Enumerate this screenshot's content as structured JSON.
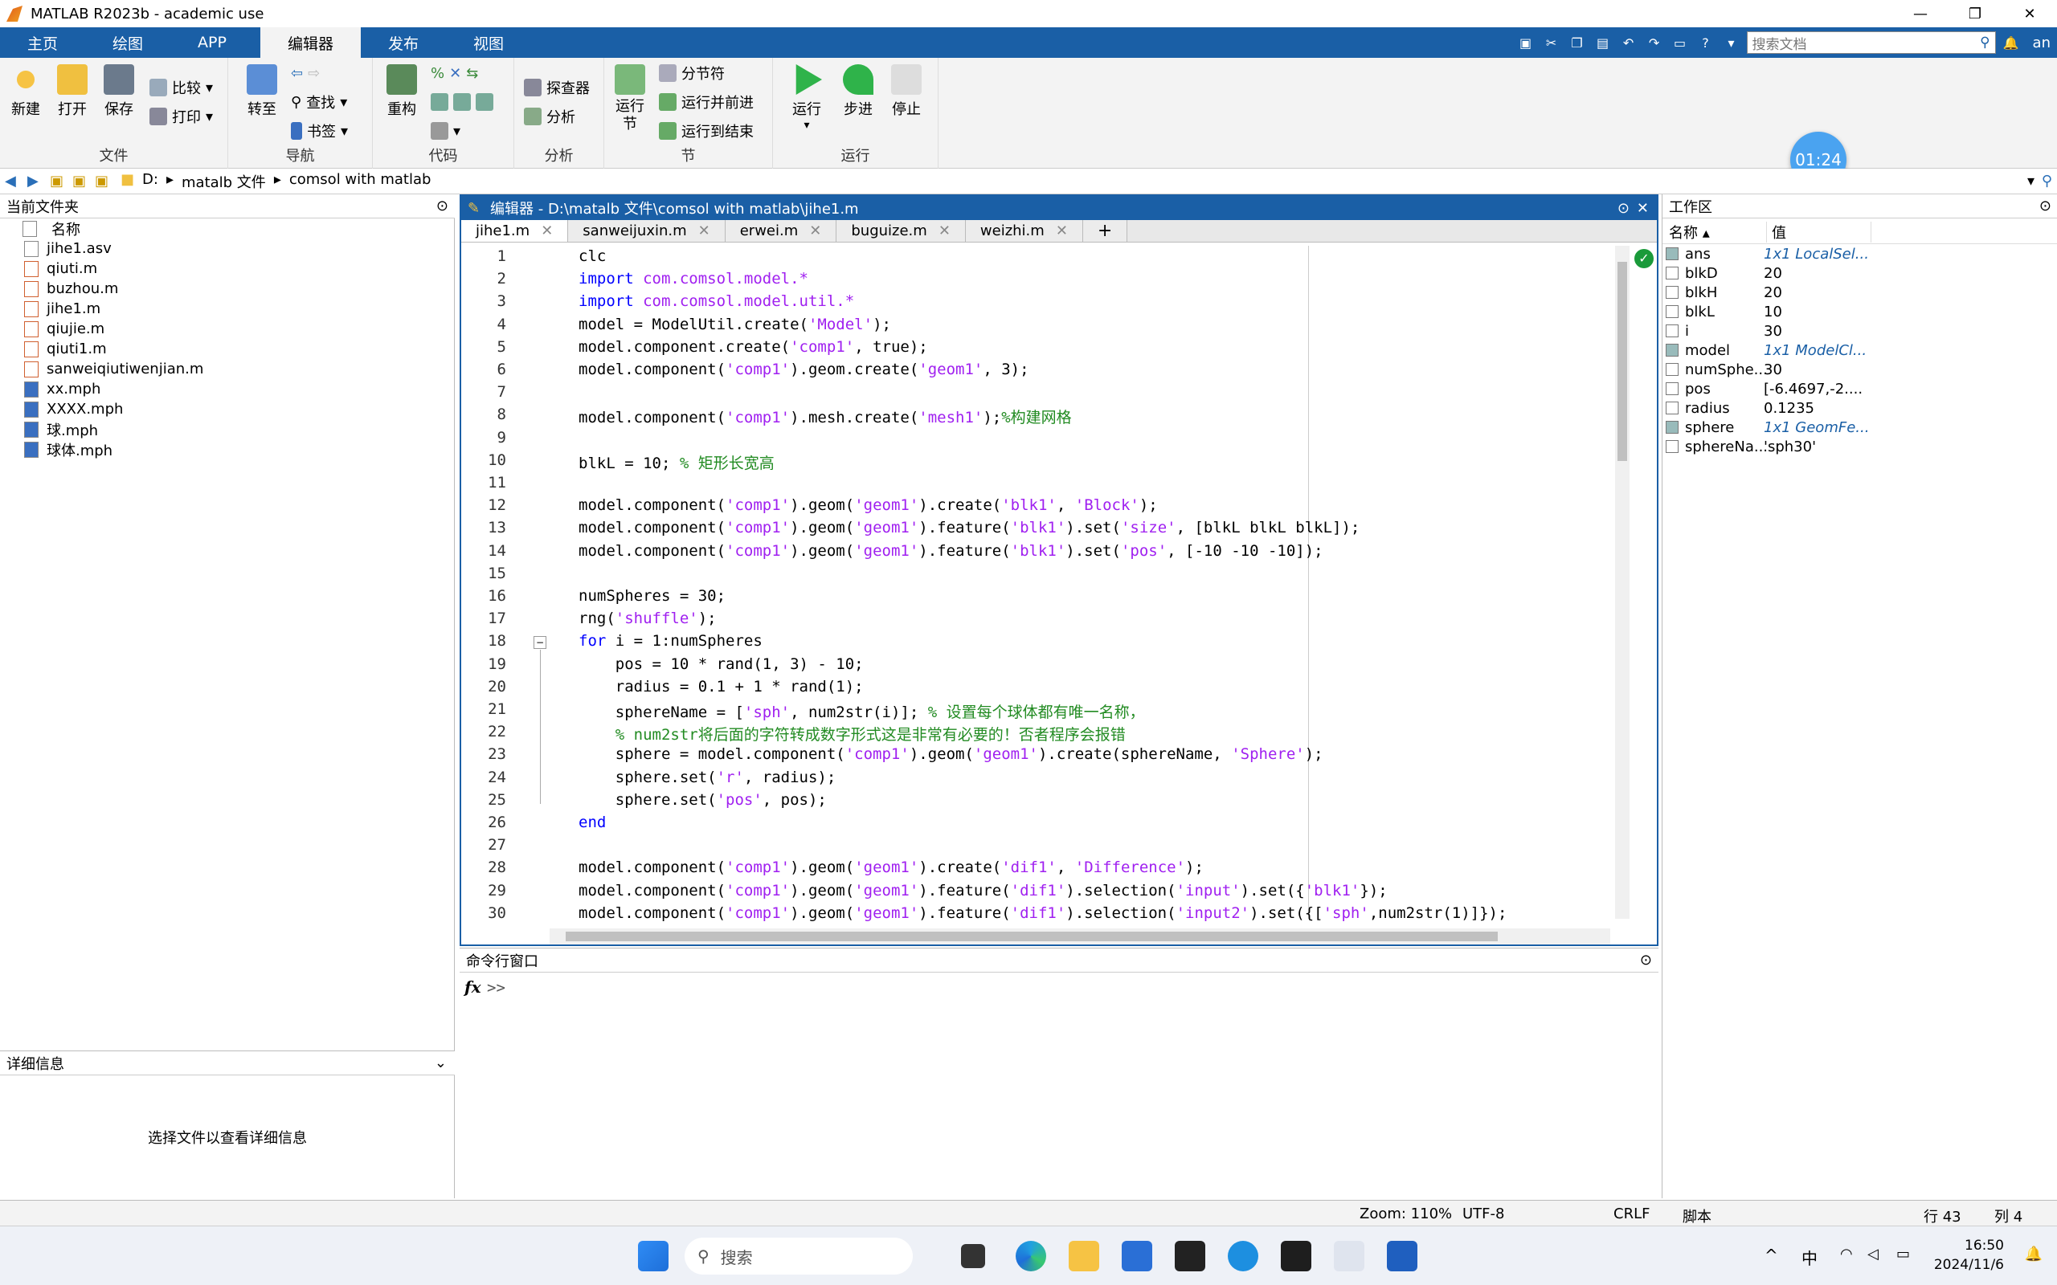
{
  "window": {
    "title": "MATLAB R2023b - academic use",
    "min": "—",
    "max": "❐",
    "close": "✕"
  },
  "ribbon_tabs": [
    "主页",
    "绘图",
    "APP",
    "编辑器",
    "发布",
    "视图"
  ],
  "quick_access": {
    "search_placeholder": "搜索文档",
    "user": "an"
  },
  "ribbon": {
    "file": {
      "label": "文件",
      "new": "新建",
      "open": "打开",
      "save": "保存",
      "compare": "比较",
      "print": "打印"
    },
    "nav": {
      "label": "导航",
      "goto": "转至",
      "find": "查找",
      "bookmark": "书签"
    },
    "code": {
      "label": "代码",
      "refactor": "重构"
    },
    "analyze": {
      "label": "分析",
      "profiler": "探查器",
      "analyze": "分析"
    },
    "section": {
      "label": "节",
      "run_section": "运行\n节",
      "section_break": "分节符",
      "run_advance": "运行并前进",
      "run_to_end": "运行到结束"
    },
    "run": {
      "label": "运行",
      "run": "运行",
      "step": "步进",
      "stop": "停止"
    }
  },
  "timer": "01:24",
  "address": {
    "drive": "D:",
    "folder1": "matalb 文件",
    "folder2": "comsol with matlab"
  },
  "current_folder": {
    "title": "当前文件夹",
    "column": "名称",
    "files": [
      "jihe1.asv",
      "qiuti.m",
      "buzhou.m",
      "jihe1.m",
      "qiujie.m",
      "qiuti1.m",
      "sanweiqiutiwenjian.m",
      "xx.mph",
      "XXXX.mph",
      "球.mph",
      "球体.mph"
    ]
  },
  "details": {
    "title": "详细信息",
    "message": "选择文件以查看详细信息"
  },
  "editor": {
    "title": "编辑器 - D:\\matalb 文件\\comsol with matlab\\jihe1.m",
    "tabs": [
      "jihe1.m",
      "sanweijuxin.m",
      "erwei.m",
      "buguize.m",
      "weizhi.m"
    ],
    "add_tab": "+"
  },
  "command_window": {
    "title": "命令行窗口",
    "prompt": ">>",
    "fx": "fx"
  },
  "workspace": {
    "title": "工作区",
    "col_name": "名称 ▴",
    "col_value": "值",
    "vars": [
      {
        "name": "ans",
        "value": "1x1 LocalSel...",
        "italic": true
      },
      {
        "name": "blkD",
        "value": "20"
      },
      {
        "name": "blkH",
        "value": "20"
      },
      {
        "name": "blkL",
        "value": "10"
      },
      {
        "name": "i",
        "value": "30"
      },
      {
        "name": "model",
        "value": "1x1 ModelCl...",
        "italic": true
      },
      {
        "name": "numSphe...",
        "value": "30"
      },
      {
        "name": "pos",
        "value": "[-6.4697,-2...."
      },
      {
        "name": "radius",
        "value": "0.1235"
      },
      {
        "name": "sphere",
        "value": "1x1 GeomFe...",
        "italic": true
      },
      {
        "name": "sphereNa...",
        "value": "'sph30'"
      }
    ]
  },
  "status": {
    "zoom": "Zoom: 110%",
    "encoding": "UTF-8",
    "eol": "CRLF",
    "type": "脚本",
    "row": "行 43",
    "col": "列 4"
  },
  "taskbar": {
    "search": "搜索",
    "time": "16:50",
    "date": "2024/11/6",
    "ime": "中"
  }
}
